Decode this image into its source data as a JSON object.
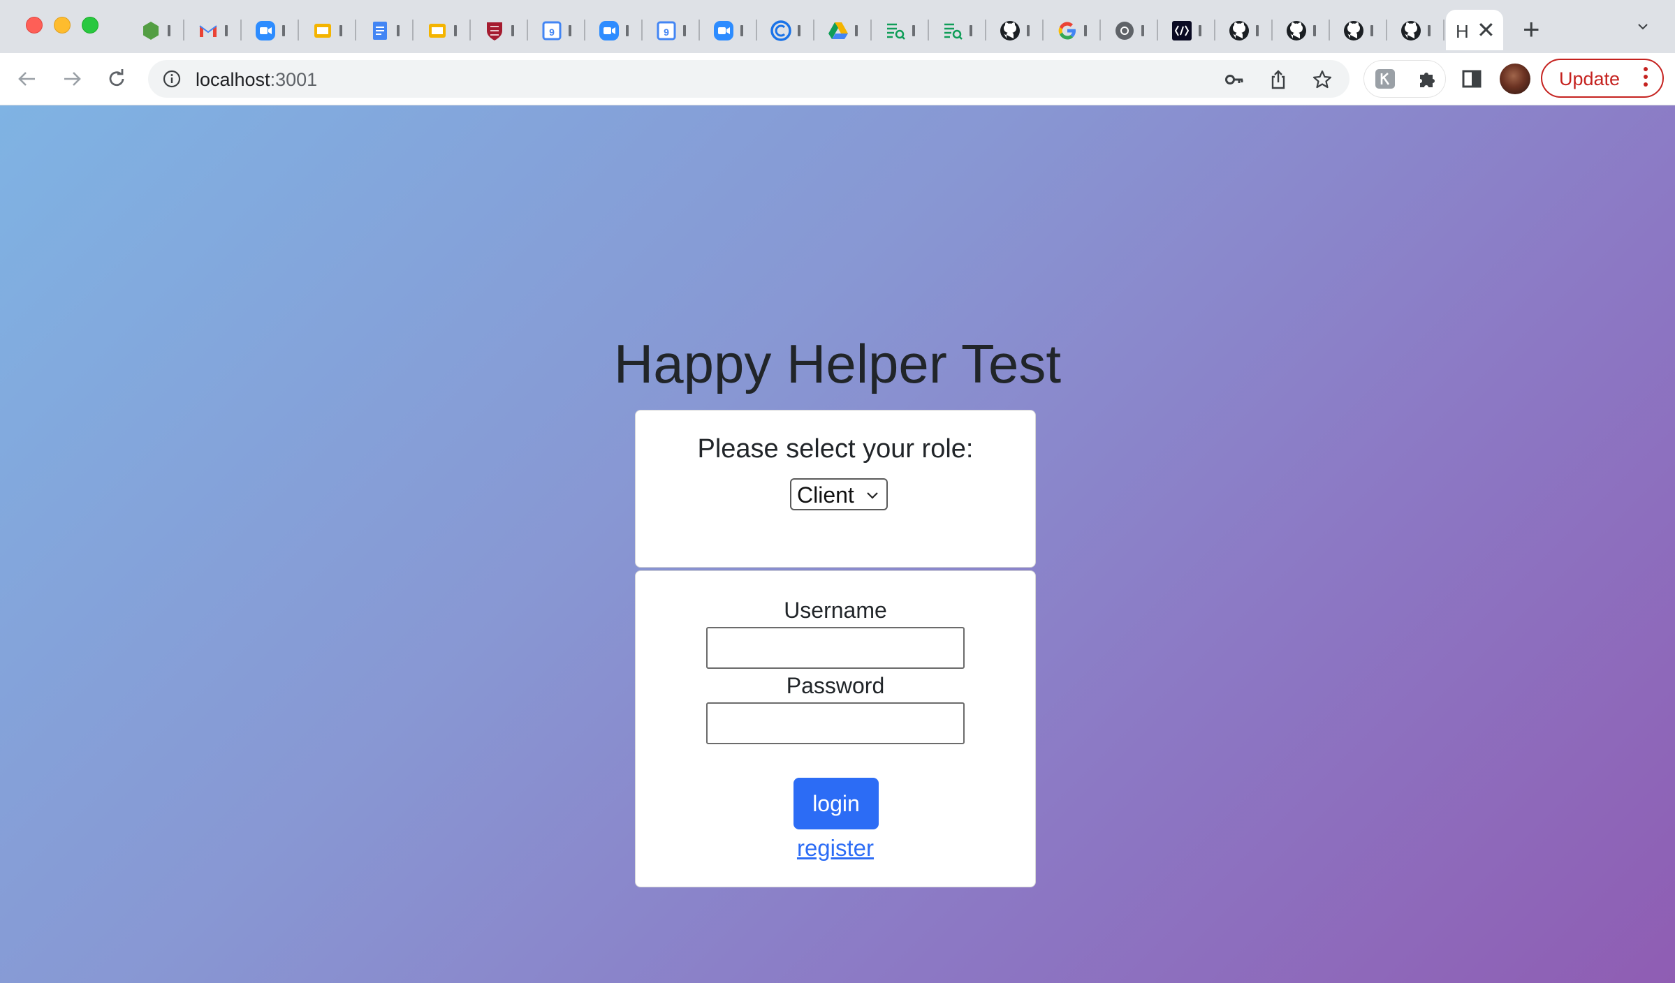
{
  "browser": {
    "tabs": [
      {
        "icon": "green-hexagon-icon",
        "color": "#539e43"
      },
      {
        "icon": "gmail-icon",
        "color": "#ea4335"
      },
      {
        "icon": "zoom-icon",
        "color": "#2d8cff"
      },
      {
        "icon": "slides-icon",
        "color": "#f4b400"
      },
      {
        "icon": "docs-icon",
        "color": "#4285f4"
      },
      {
        "icon": "slides-icon",
        "color": "#f4b400"
      },
      {
        "icon": "harvard-shield-icon",
        "color": "#a51c30"
      },
      {
        "icon": "calendar-icon",
        "color": "#4285f4"
      },
      {
        "icon": "zoom-icon",
        "color": "#2d8cff"
      },
      {
        "icon": "calendar-icon",
        "color": "#4285f4"
      },
      {
        "icon": "zoom-icon",
        "color": "#2d8cff"
      },
      {
        "icon": "c-circle-icon",
        "color": "#1a73e8"
      },
      {
        "icon": "drive-icon",
        "color": "#0f9d58"
      },
      {
        "icon": "sheet-search-icon",
        "color": "#0f9d58"
      },
      {
        "icon": "sheet-search-icon",
        "color": "#0f9d58"
      },
      {
        "icon": "github-icon",
        "color": "#1b1f23"
      },
      {
        "icon": "google-icon",
        "color": "#4285f4"
      },
      {
        "icon": "chrome-icon",
        "color": "#5f6368"
      },
      {
        "icon": "devcode-icon",
        "color": "#0a0a23"
      },
      {
        "icon": "github-icon",
        "color": "#1b1f23"
      },
      {
        "icon": "github-icon",
        "color": "#1b1f23"
      },
      {
        "icon": "github-icon",
        "color": "#1b1f23"
      },
      {
        "icon": "github-icon",
        "color": "#1b1f23"
      }
    ],
    "active_tab": {
      "title": "H",
      "close": "✕"
    },
    "new_tab": "+",
    "url_host": "localhost",
    "url_port": ":3001",
    "update_label": "Update"
  },
  "page": {
    "title": "Happy Helper Test",
    "role_prompt": "Please select your role:",
    "role_selected": "Client",
    "username_label": "Username",
    "password_label": "Password",
    "login_label": "login",
    "register_label": "register",
    "accent_color": "#2c6cf5"
  }
}
